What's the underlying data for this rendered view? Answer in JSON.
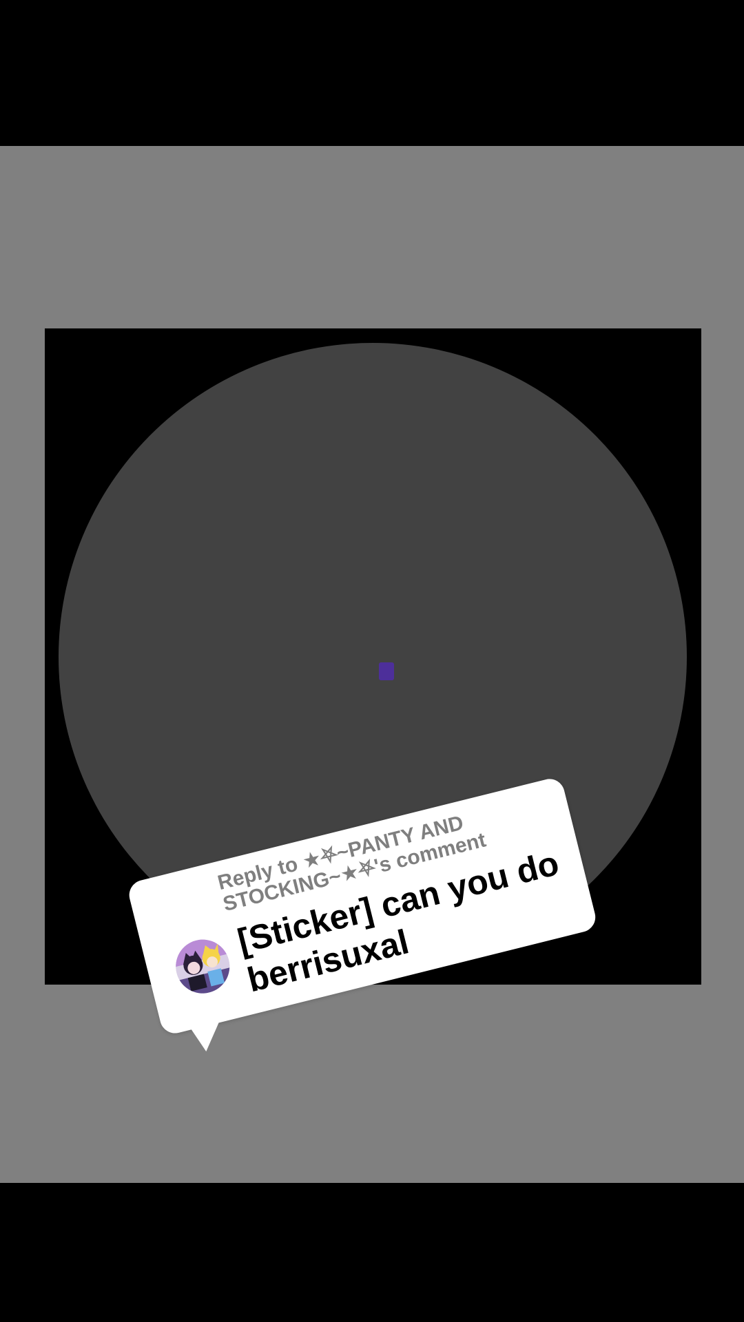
{
  "reply_sticker": {
    "header": "Reply to ★⛧~PANTY AND STOCKING~★⛧'s comment",
    "comment": "[Sticker] can you do berrisuxal",
    "avatar_icon": "user-avatar-icon"
  },
  "colors": {
    "background": "#000000",
    "panel": "#808080",
    "disc": "#424242",
    "center_dot": "#4d2f9a",
    "reply_header": "#7f7f7f"
  }
}
